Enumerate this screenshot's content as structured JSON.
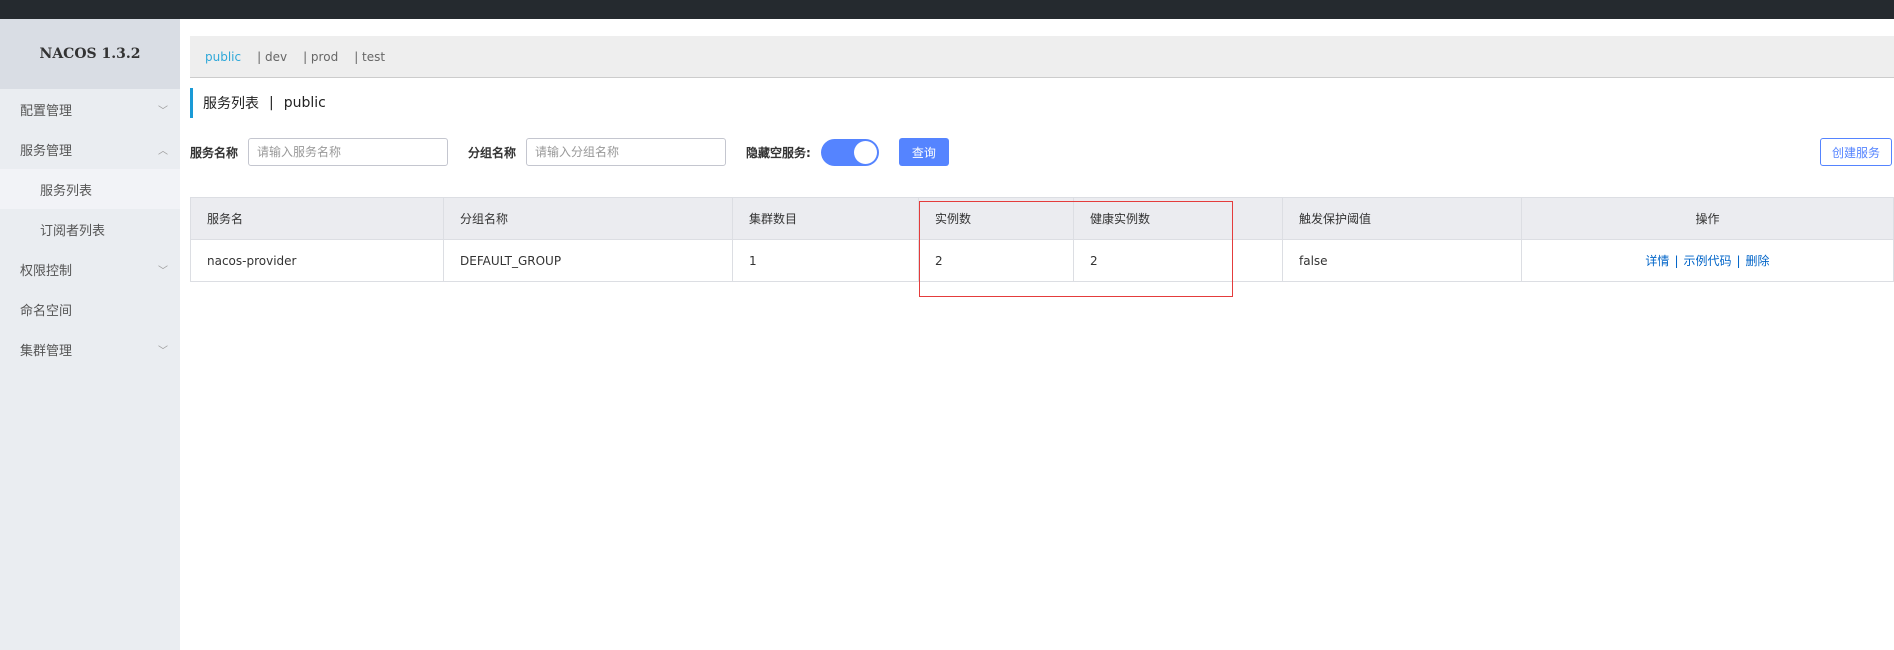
{
  "app": {
    "logo": "NACOS 1.3.2"
  },
  "sidebar": {
    "items": [
      {
        "label": "配置管理",
        "chevron": "chevron-down-icon"
      },
      {
        "label": "服务管理",
        "chevron": "chevron-up-icon"
      },
      {
        "label": "服务列表"
      },
      {
        "label": "订阅者列表"
      },
      {
        "label": "权限控制",
        "chevron": "chevron-down-icon"
      },
      {
        "label": "命名空间"
      },
      {
        "label": "集群管理",
        "chevron": "chevron-down-icon"
      }
    ]
  },
  "namespaces": [
    "public",
    "| dev",
    "| prod",
    "| test"
  ],
  "page": {
    "title": "服务列表",
    "sep": "|",
    "ns": "public"
  },
  "filters": {
    "service_label": "服务名称",
    "service_placeholder": "请输入服务名称",
    "group_label": "分组名称",
    "group_placeholder": "请输入分组名称",
    "hide_empty_label": "隐藏空服务:",
    "hide_empty_on": true,
    "query": "查询",
    "create": "创建服务"
  },
  "table": {
    "headers": [
      "服务名",
      "分组名称",
      "集群数目",
      "实例数",
      "健康实例数",
      "触发保护阈值",
      "操作"
    ],
    "rows": [
      {
        "name": "nacos-provider",
        "group": "DEFAULT_GROUP",
        "clusters": "1",
        "instances": "2",
        "healthy": "2",
        "threshold": "false",
        "actions": [
          "详情",
          "示例代码",
          "删除"
        ],
        "sep": "|"
      }
    ]
  },
  "colors": {
    "accent": "#5584ff",
    "highlight": "#e43c3c"
  }
}
